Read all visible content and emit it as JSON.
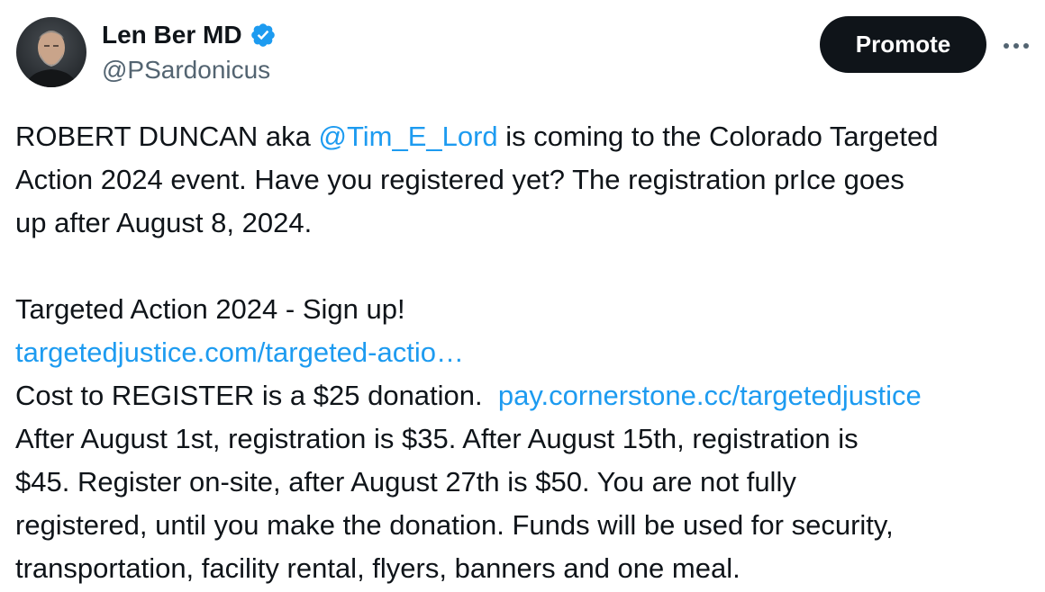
{
  "author": {
    "display_name": "Len Ber MD",
    "handle": "@PSardonicus",
    "verified": true,
    "avatar_icon": "user-avatar-photo",
    "verified_icon": "verified-badge-icon",
    "verified_color": "#1d9bf0"
  },
  "actions": {
    "promote_label": "Promote",
    "more_icon": "more-horizontal-icon"
  },
  "tweet": {
    "link_color": "#1d9bf0",
    "p1_l1_a": "ROBERT DUNCAN aka ",
    "p1_l1_mention": "@Tim_E_Lord",
    "p1_l1_b": " is coming to the Colorado Targeted",
    "p1_l2": "Action 2024 event. Have you registered yet? The registration prIce goes",
    "p1_l3": "up after August 8, 2024.",
    "p2_l1": "Targeted Action 2024 - Sign up!",
    "p2_l2_link": "targetedjustice.com/targeted-actio…",
    "p2_l3_a": "Cost to REGISTER is a $25 donation.  ",
    "p2_l3_link": "pay.cornerstone.cc/targetedjustice",
    "p2_l4": "After August 1st, registration is $35. After August 15th, registration is",
    "p2_l5": "$45. Register on-site, after August 27th is $50. You are not fully",
    "p2_l6": "registered, until you make the donation. Funds will be used for security,",
    "p2_l7": "transportation, facility rental, flyers, banners and one meal."
  }
}
